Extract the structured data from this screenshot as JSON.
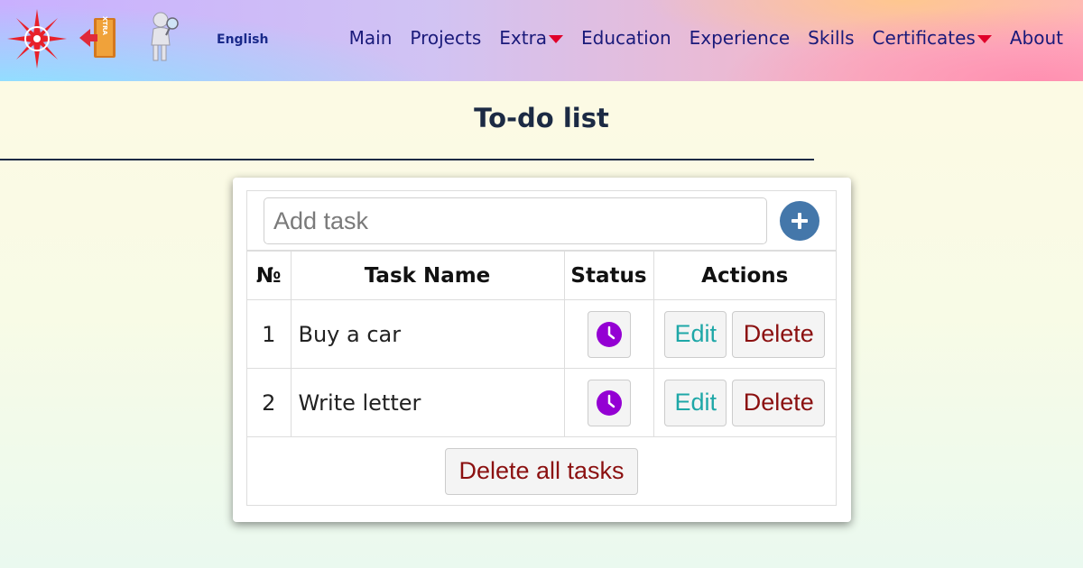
{
  "header": {
    "language": "English",
    "nav": [
      {
        "label": "Main",
        "has_dropdown": false
      },
      {
        "label": "Projects",
        "has_dropdown": false
      },
      {
        "label": "Extra",
        "has_dropdown": true
      },
      {
        "label": "Education",
        "has_dropdown": false
      },
      {
        "label": "Experience",
        "has_dropdown": false
      },
      {
        "label": "Skills",
        "has_dropdown": false
      },
      {
        "label": "Certificates",
        "has_dropdown": true
      },
      {
        "label": "About",
        "has_dropdown": false
      }
    ],
    "icons": [
      "compass-logo-icon",
      "extra-exit-icon",
      "search-person-icon"
    ],
    "extra_icon_text": "EXTRA"
  },
  "page": {
    "title": "To-do list"
  },
  "todo": {
    "input_placeholder": "Add task",
    "input_value": "",
    "columns": {
      "num": "№",
      "name": "Task Name",
      "status": "Status",
      "actions": "Actions"
    },
    "tasks": [
      {
        "num": "1",
        "name": "Buy a car",
        "status": "pending"
      },
      {
        "num": "2",
        "name": "Write letter",
        "status": "pending"
      }
    ],
    "edit_label": "Edit",
    "delete_label": "Delete",
    "delete_all_label": "Delete all tasks"
  },
  "colors": {
    "nav_text": "#1a1a7a",
    "caret": "#e0002a",
    "add_button": "#4477aa",
    "status_clock": "#9400d3",
    "edit_text": "#1ea7a7",
    "delete_text": "#8b1010",
    "title_text": "#1c2a44"
  }
}
